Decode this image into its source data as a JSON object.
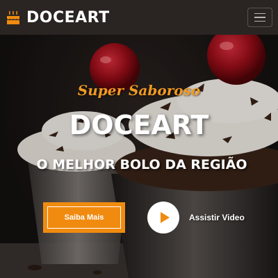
{
  "navbar": {
    "brand_name": "DOCEART",
    "brand_icon": "birthday-cake-icon",
    "menu_icon": "hamburger-menu-icon"
  },
  "hero": {
    "tagline": "Super Saboroso",
    "title": "DOCEART",
    "subtitle": "O MELHOR BOLO DA REGIÃO",
    "primary_button": "Saiba Mais",
    "video_label": "Assistir Video",
    "play_icon": "play-icon"
  },
  "colors": {
    "accent": "#f08b10",
    "navbar_bg": "#2a2522",
    "text": "#ffffff"
  }
}
